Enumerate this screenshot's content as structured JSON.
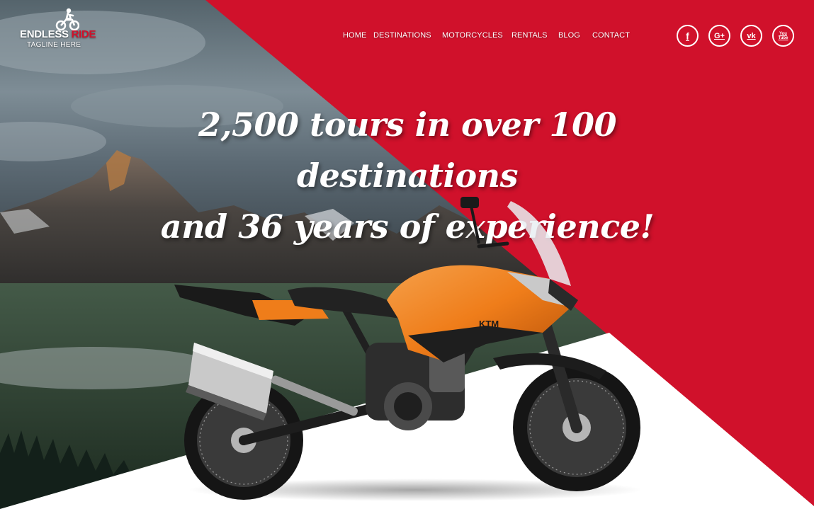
{
  "colors": {
    "brand_red": "#d0112b",
    "white": "#ffffff",
    "bike_orange": "#ef7d1a"
  },
  "logo": {
    "name_part1": "ENDLESS",
    "name_part2": "RIDE",
    "tagline": "TAGLINE HERE",
    "icon": "motocross-rider-icon"
  },
  "nav": {
    "items": [
      {
        "label": "HOME"
      },
      {
        "label": "DESTINATIONS"
      },
      {
        "label": "MOTORCYCLES"
      },
      {
        "label": "RENTALS"
      },
      {
        "label": "BLOG"
      },
      {
        "label": "CONTACT"
      }
    ]
  },
  "social": [
    {
      "icon": "facebook-icon",
      "glyph": "f"
    },
    {
      "icon": "google-plus-icon",
      "glyph": "G+"
    },
    {
      "icon": "vk-icon",
      "glyph": "vk"
    },
    {
      "icon": "youtube-icon",
      "glyph": "You Tube"
    }
  ],
  "hero": {
    "line1": "2,500 tours in over 100 destinations",
    "line2": "and 36 years of experience!",
    "bike_brand": "KTM"
  }
}
